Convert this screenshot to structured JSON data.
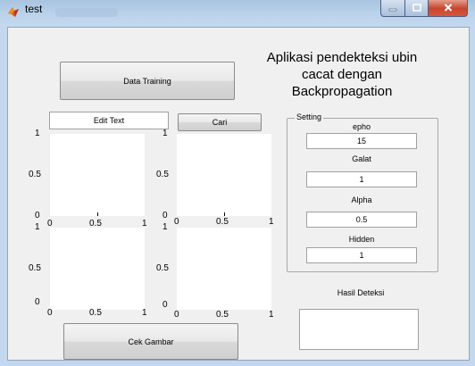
{
  "window": {
    "title": "test",
    "icons": {
      "app": "matlab-logo-icon",
      "minimize": "minimize-icon",
      "maximize": "maximize-icon",
      "close": "close-icon"
    }
  },
  "heading": {
    "line1": "Aplikasi pendekteksi ubin",
    "line2": "cacat dengan",
    "line3": "Backpropagation"
  },
  "buttons": {
    "data_training": "Data Training",
    "cari": "Cari",
    "cek_gambar": "Cek Gambar"
  },
  "edit_text": {
    "value": "Edit Text"
  },
  "axes": {
    "top_left": {
      "y_ticks": [
        "1",
        "0.5",
        "0"
      ],
      "x_ticks": [
        "0",
        "0.5",
        "1"
      ]
    },
    "top_right": {
      "y_ticks": [
        "1",
        "0.5",
        "0"
      ],
      "x_ticks": [
        "0",
        "0.5",
        "1"
      ]
    },
    "bottom_left": {
      "y_ticks": [
        "1",
        "0.5",
        "0"
      ],
      "x_ticks": [
        "0",
        "0.5",
        "1"
      ]
    },
    "bottom_right": {
      "y_ticks": [
        "1",
        "0.5",
        "0"
      ],
      "x_ticks": [
        "0",
        "0.5",
        "1"
      ]
    }
  },
  "setting": {
    "title": "Setting",
    "fields": [
      {
        "label": "epho",
        "value": "15"
      },
      {
        "label": "Galat",
        "value": "1"
      },
      {
        "label": "Alpha",
        "value": "0.5"
      },
      {
        "label": "Hidden",
        "value": "1"
      }
    ]
  },
  "result": {
    "label": "Hasil Deteksi",
    "value": ""
  }
}
